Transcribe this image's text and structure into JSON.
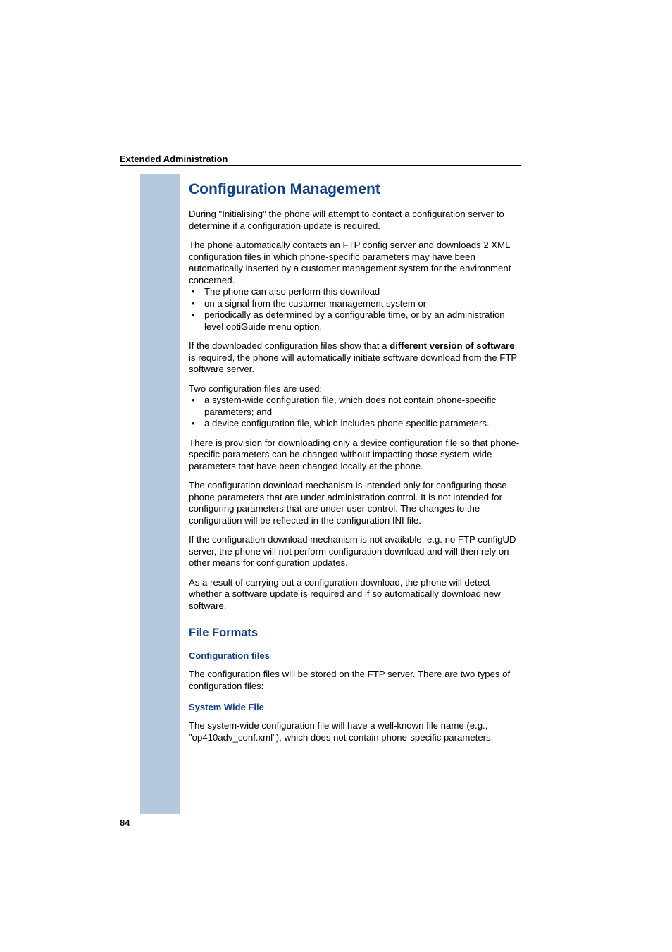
{
  "header": {
    "section": "Extended Administration"
  },
  "main": {
    "title": "Configuration Management",
    "p1": "During \"Initialising\" the phone will attempt to contact a configuration server to determine if a configuration update is required.",
    "p2": "The phone automatically contacts an FTP config server and downloads 2 XML configuration files in which phone-specific parameters may have been automatically inserted by a customer management system for the environment concerned.",
    "bullets1": [
      "The phone can also perform this download",
      "on a signal from the customer management system or",
      "periodically as determined by a configurable time, or by an administration level optiGuide menu option."
    ],
    "p3a": "If the downloaded configuration files show that a ",
    "p3bold": "different version of software",
    "p3b": " is required, the phone will automatically initiate software download from the FTP software server.",
    "p4": "Two configuration files are used:",
    "bullets2": [
      "a system-wide configuration file, which does not contain phone-specific parameters; and",
      "a device configuration file, which includes phone-specific parameters."
    ],
    "p5": "There is provision for downloading only a device configuration file so that phone-specific parameters can be changed without impacting those system-wide parameters that have been changed locally at the phone.",
    "p6": "The configuration download mechanism is intended only for configuring those phone parameters that are under administration control. It is not intended for configuring parameters that are under user control. The changes to the configuration will be reflected in the configuration INI file.",
    "p7": "If the configuration download mechanism is not available, e.g. no FTP configUD server, the phone will not perform configuration download and will then rely on other means for configuration updates.",
    "p8": "As a result of carrying out a configuration download, the phone will detect whether a software update is required and if so automatically download new software."
  },
  "fileFormats": {
    "title": "File Formats",
    "configFiles": {
      "title": "Configuration files",
      "p1": "The configuration files will be stored on the FTP server. There are two types of configuration files:"
    },
    "systemWide": {
      "title": "System Wide File",
      "p1": "The system-wide configuration file will have a well-known file name (e.g., \"op410adv_conf.xml\"), which does not contain phone-specific parameters."
    }
  },
  "pageNumber": "84"
}
